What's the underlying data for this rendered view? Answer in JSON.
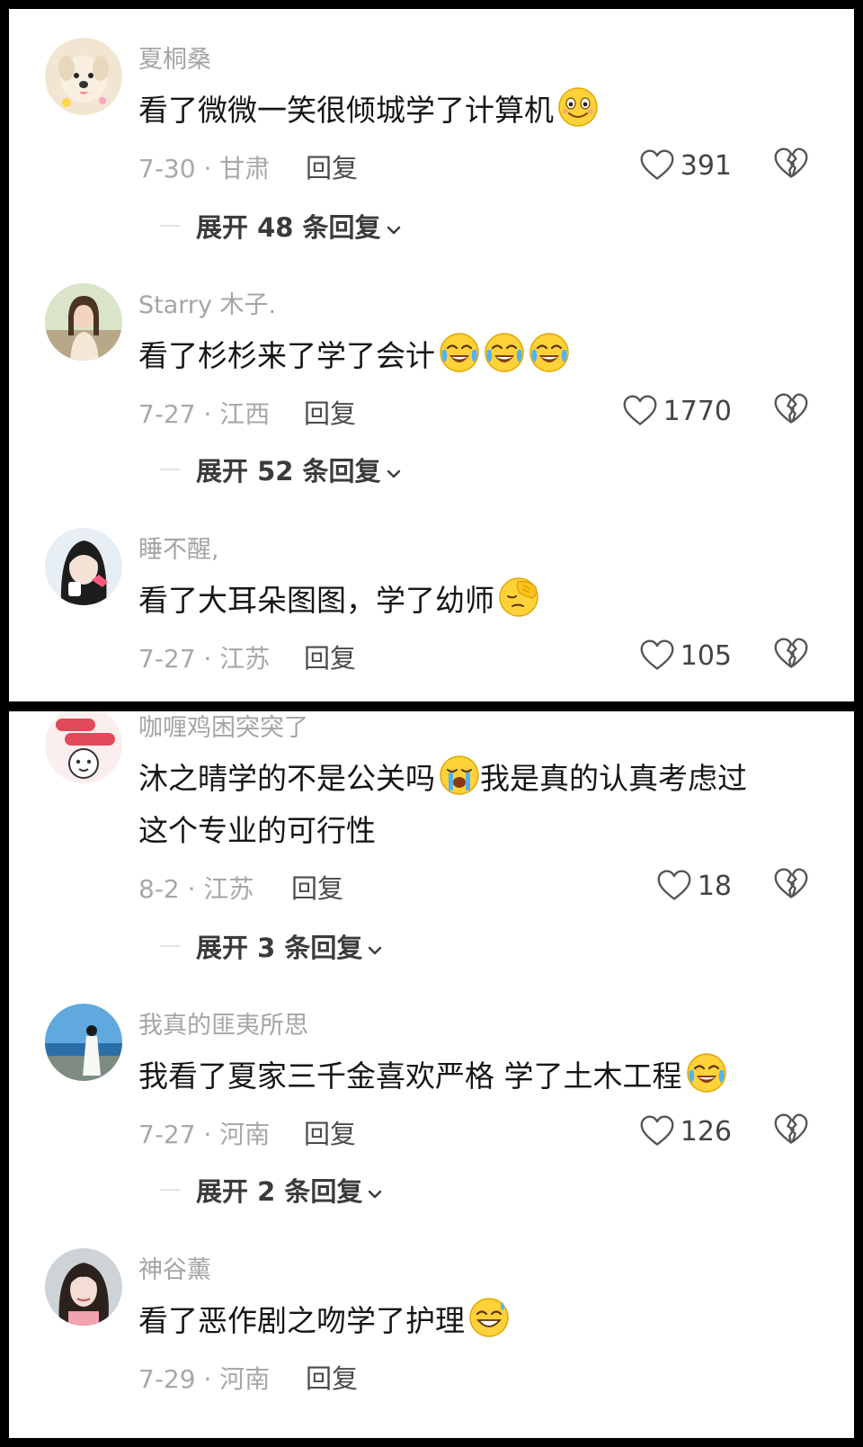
{
  "comments": [
    {
      "username": "夏桐桑",
      "text": "看了微微一笑很倾城学了计算机",
      "date_location": "7-30 · 甘肃",
      "reply_label": "回复",
      "likes": "391",
      "expand_label": "展开 48 条回复",
      "emojis": [
        "smile-emoji"
      ]
    },
    {
      "username": "Starry 木子.",
      "text": "看了杉杉来了学了会计",
      "date_location": "7-27 · 江西",
      "reply_label": "回复",
      "likes": "1770",
      "expand_label": "展开 52 条回复",
      "emojis": [
        "cry-laugh-emoji",
        "cry-laugh-emoji",
        "cry-laugh-emoji"
      ]
    },
    {
      "username": "睡不醒,",
      "text": "看了大耳朵图图，学了幼师",
      "date_location": "7-27 · 江苏",
      "reply_label": "回复",
      "likes": "105",
      "emojis": [
        "facepalm-emoji"
      ]
    },
    {
      "username": "咖喱鸡困突突了",
      "text_line1": "沐之晴学的不是公关吗",
      "text_line1b": "我是真的认真考虑过",
      "text_line2": "这个专业的可行性",
      "date_location": "8-2 · 江苏",
      "reply_label": "回复",
      "likes": "18",
      "expand_label": "展开 3 条回复",
      "emojis": [
        "crying-emoji"
      ]
    },
    {
      "username": "我真的匪夷所思",
      "text": "我看了夏家三千金喜欢严格 学了土木工程",
      "date_location": "7-27 · 河南",
      "reply_label": "回复",
      "likes": "126",
      "expand_label": "展开 2 条回复",
      "emojis": [
        "cry-laugh-emoji"
      ]
    },
    {
      "username": "神谷薰",
      "text": "看了恶作剧之吻学了护理",
      "date_location": "7-29 · 河南",
      "reply_label": "回复",
      "emojis": [
        "grin-sweat-emoji"
      ]
    }
  ],
  "colors": {
    "username": "#a5a5a5",
    "text": "#161616",
    "meta": "#a8a8a8",
    "emoji_yellow": "#ffd23a",
    "tear_blue": "#4fb3f5"
  }
}
